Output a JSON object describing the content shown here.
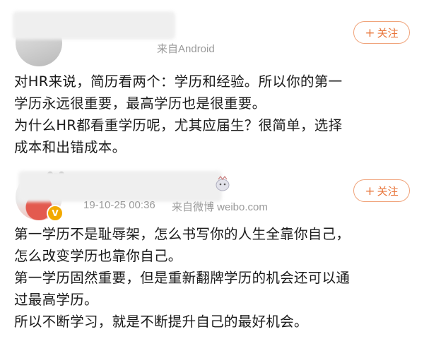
{
  "posts": [
    {
      "source": "来自Android",
      "follow_label": "关注",
      "content": "对HR来说，简历看两个：学历和经验。所以你的第一\n学历永远很重要，最高学历也是很重要。\n为什么HR都看重学历呢，尤其应届生？很简单，选择\n成本和出错成本。"
    },
    {
      "timestamp": "19-10-25 00:36",
      "source": "来自微博 weibo.com",
      "follow_label": "关注",
      "content": "第一学历不是耻辱架，怎么书写你的人生全靠你自己，\n怎么改变学历也靠你自己。\n第一学历固然重要，但是重新翻牌学历的机会还可以通\n过最高学历。\n所以不断学习，就是不断提升自己的最好机会。"
    }
  ],
  "colors": {
    "follow_accent": "#e8753a",
    "follow_border": "#f0a37a",
    "meta_text": "#9a9a9a",
    "badge": "#f2a900"
  },
  "icons": {
    "plus": "plus-icon",
    "verified": "verified-badge-icon",
    "panda": "panda-sticker-icon"
  }
}
